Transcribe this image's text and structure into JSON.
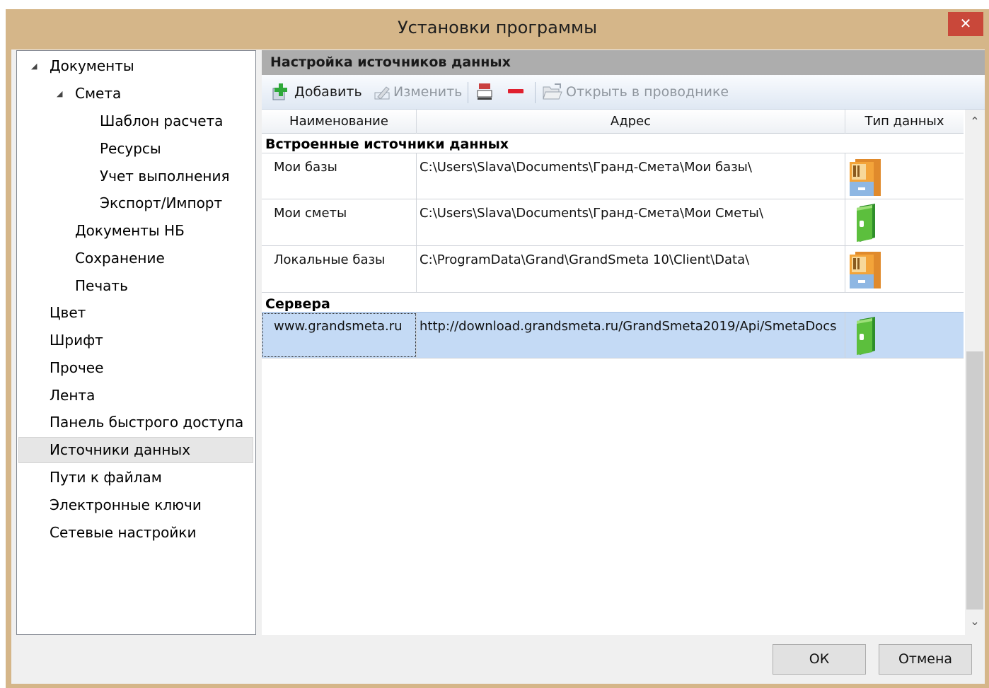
{
  "window": {
    "title": "Установки программы",
    "close_glyph": "✕"
  },
  "tree": {
    "items": [
      {
        "label": "Документы",
        "expanded": true
      },
      {
        "label": "Смета",
        "expanded": true
      },
      {
        "label": "Шаблон расчета"
      },
      {
        "label": "Ресурсы"
      },
      {
        "label": "Учет выполнения"
      },
      {
        "label": "Экспорт/Импорт"
      },
      {
        "label": "Документы НБ"
      },
      {
        "label": "Сохранение"
      },
      {
        "label": "Печать"
      },
      {
        "label": "Цвет"
      },
      {
        "label": "Шрифт"
      },
      {
        "label": "Прочее"
      },
      {
        "label": "Лента"
      },
      {
        "label": "Панель быстрого доступа"
      },
      {
        "label": "Источники данных",
        "selected": true
      },
      {
        "label": "Пути к файлам"
      },
      {
        "label": "Электронные ключи"
      },
      {
        "label": "Сетевые настройки"
      }
    ]
  },
  "panel": {
    "header": "Настройка источников данных",
    "toolbar": {
      "add": "Добавить",
      "edit": "Изменить",
      "open_explorer": "Открыть в проводнике"
    },
    "grid": {
      "columns": [
        "Наименование",
        "Адрес",
        "Тип данных"
      ],
      "groups": [
        {
          "title": "Встроенные источники данных",
          "rows": [
            {
              "name": "Мои базы",
              "address": "C:\\Users\\Slava\\Documents\\Гранд-Смета\\Мои базы\\",
              "type_icon": "cabinet-icon"
            },
            {
              "name": "Мои сметы",
              "address": "C:\\Users\\Slava\\Documents\\Гранд-Смета\\Мои Сметы\\",
              "type_icon": "binder-icon"
            },
            {
              "name": "Локальные базы",
              "address": "C:\\ProgramData\\Grand\\GrandSmeta 10\\Client\\Data\\",
              "type_icon": "cabinet-icon"
            }
          ]
        },
        {
          "title": "Сервера",
          "rows": [
            {
              "name": "www.grandsmeta.ru",
              "address": "http://download.grandsmeta.ru/GrandSmeta2019/Api/SmetaDocs",
              "type_icon": "binder-icon",
              "selected": true
            }
          ]
        }
      ]
    }
  },
  "buttons": {
    "ok": "ОК",
    "cancel": "Отмена"
  },
  "colors": {
    "frame": "#d5b689",
    "close": "#c9483a",
    "selection": "#c4daf5"
  }
}
